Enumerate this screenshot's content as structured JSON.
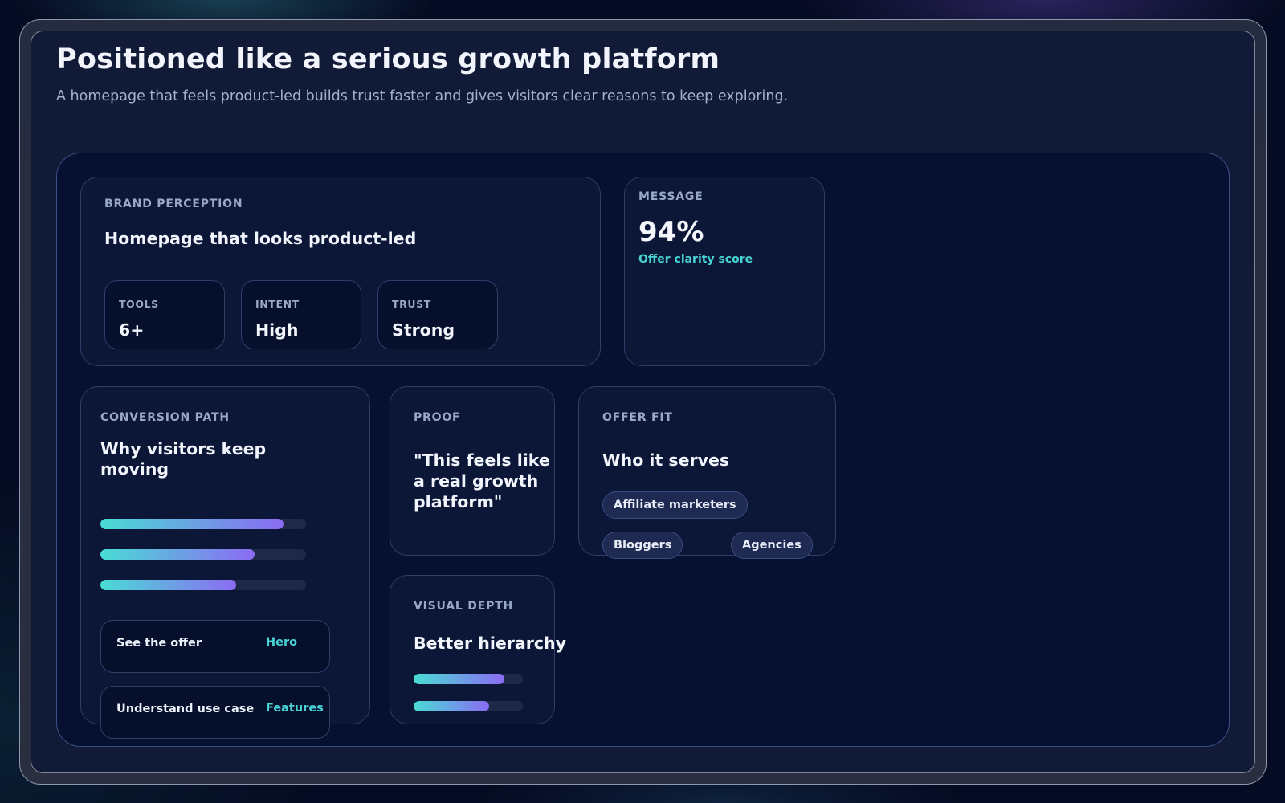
{
  "header": {
    "title": "Positioned like a serious growth platform",
    "subtitle": "A homepage that feels product-led builds trust faster and gives visitors clear reasons to keep exploring."
  },
  "brand": {
    "eyebrow": "BRAND PERCEPTION",
    "title": "Homepage that looks product-led",
    "stats": [
      {
        "label": "TOOLS",
        "value": "6+"
      },
      {
        "label": "INTENT",
        "value": "High"
      },
      {
        "label": "TRUST",
        "value": "Strong"
      }
    ]
  },
  "message": {
    "eyebrow": "MESSAGE",
    "value": "94%",
    "caption": "Offer clarity score"
  },
  "conversion": {
    "eyebrow": "CONVERSION PATH",
    "title": "Why visitors keep moving",
    "bars": [
      0.89,
      0.75,
      0.66
    ],
    "steps": [
      {
        "label": "See the offer",
        "tag": "Hero"
      },
      {
        "label": "Understand use case",
        "tag": "Features"
      }
    ]
  },
  "proof": {
    "eyebrow": "PROOF",
    "quote": "\"This feels like a real growth platform\""
  },
  "offer_fit": {
    "eyebrow": "OFFER FIT",
    "title": "Who it serves",
    "chips": [
      "Affiliate marketers",
      "Bloggers",
      "Agencies"
    ]
  },
  "visual_depth": {
    "eyebrow": "VISUAL DEPTH",
    "title": "Better hierarchy",
    "bars": [
      0.83,
      0.69
    ]
  },
  "colors": {
    "accent_teal": "#47d3d3",
    "accent_violet": "#8b6bf3",
    "panel": "#0c1738"
  }
}
